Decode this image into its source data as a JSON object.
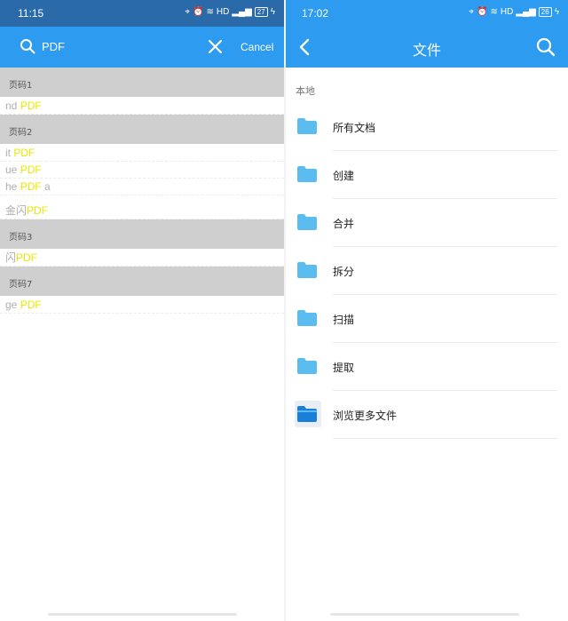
{
  "left": {
    "status": {
      "time": "11:15",
      "network": "HD",
      "battery": "27"
    },
    "search": {
      "query": "PDF",
      "cancel_label": "Cancel"
    },
    "results": [
      {
        "type": "header",
        "label": "页码1"
      },
      {
        "type": "row",
        "before": "nd ",
        "match": "PDF",
        "after": ""
      },
      {
        "type": "header",
        "label": "页码2"
      },
      {
        "type": "row",
        "before": "it ",
        "match": "PDF",
        "after": ""
      },
      {
        "type": "row",
        "before": "ue ",
        "match": "PDF",
        "after": ""
      },
      {
        "type": "row",
        "before": "he ",
        "match": "PDF",
        "after": " a"
      },
      {
        "type": "row",
        "before": "金闪",
        "match": "PDF",
        "after": ""
      },
      {
        "type": "header",
        "label": "页码3"
      },
      {
        "type": "row",
        "before": "闪",
        "match": "PDF",
        "after": ""
      },
      {
        "type": "header",
        "label": "页码7"
      },
      {
        "type": "row",
        "before": "ge ",
        "match": "PDF",
        "after": ""
      }
    ]
  },
  "right": {
    "status": {
      "time": "17:02",
      "network": "HD",
      "battery": "26"
    },
    "title": "文件",
    "section_label": "本地",
    "folders": [
      {
        "label": "所有文档",
        "icon": "folder-icon"
      },
      {
        "label": "创建",
        "icon": "folder-icon"
      },
      {
        "label": "合并",
        "icon": "folder-icon"
      },
      {
        "label": "拆分",
        "icon": "folder-icon"
      },
      {
        "label": "扫描",
        "icon": "folder-icon"
      },
      {
        "label": "提取",
        "icon": "folder-icon"
      },
      {
        "label": "浏览更多文件",
        "icon": "browse-folder-icon"
      }
    ]
  },
  "colors": {
    "primary": "#2d9bf0",
    "status_dark": "#2b6aa8",
    "highlight": "#e8e800",
    "folder": "#5bbcf0",
    "folder_dark": "#1a7fd6"
  }
}
